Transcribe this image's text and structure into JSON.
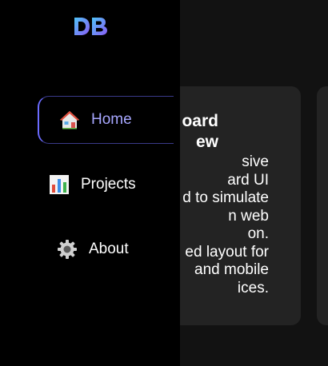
{
  "app": {
    "logo_text": "DB"
  },
  "sidebar": {
    "items": [
      {
        "label": "Home",
        "icon": "house-icon",
        "active": true
      },
      {
        "label": "Projects",
        "icon": "bar-chart-icon",
        "active": false
      },
      {
        "label": "About",
        "icon": "gear-icon",
        "active": false
      }
    ]
  },
  "main": {
    "card": {
      "title": "oard\new",
      "description": "sive\nard UI\nd to simulate\nn web\non.\ned layout for\n and mobile\nices."
    }
  },
  "colors": {
    "sidebar_bg": "#000000",
    "content_bg": "#121212",
    "card_bg": "#232323",
    "accent": "#6b6bff",
    "active_text": "#a7a7ff"
  }
}
